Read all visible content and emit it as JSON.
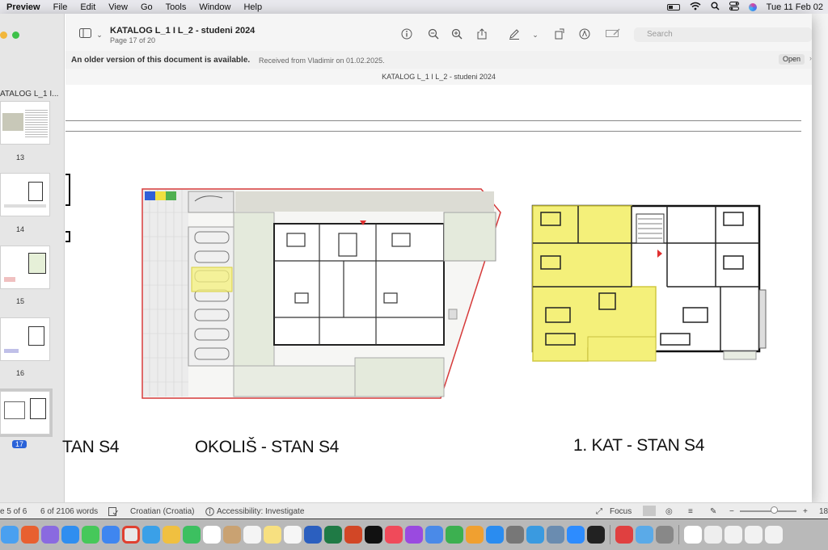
{
  "menubar": {
    "app_name": "Preview",
    "items": [
      "File",
      "Edit",
      "View",
      "Go",
      "Tools",
      "Window",
      "Help"
    ],
    "clock": "Tue 11 Feb  02"
  },
  "window": {
    "doc_title": "KATALOG L_1 I L_2 - studeni 2024",
    "page_indicator": "Page 17 of 20",
    "search_placeholder": "Search",
    "notice_main": "An older version of this document is available.",
    "notice_sub": "Received from Vladimir on 01.02.2025.",
    "open_label": "Open",
    "page_header": "KATALOG L_1 I L_2 - studeni 2024"
  },
  "sidebar": {
    "doc_label": "ATALOG L_1 I...",
    "thumbnails": [
      {
        "number": "13"
      },
      {
        "number": "14"
      },
      {
        "number": "15"
      },
      {
        "number": "16"
      },
      {
        "number": "17"
      }
    ]
  },
  "page_content": {
    "caption_left": "TAN S4",
    "caption_middle": "OKOLIŠ - STAN S4",
    "caption_right": "1. KAT - STAN S4",
    "highlight_color": "#f4f07a",
    "parking_highlight_color": "#f6f27c"
  },
  "statusbar": {
    "page_of": "e 5 of 6",
    "word_count": "6 of 2106 words",
    "language": "Croatian (Croatia)",
    "accessibility": "Accessibility: Investigate",
    "focus": "Focus",
    "zoom_value": "18"
  }
}
